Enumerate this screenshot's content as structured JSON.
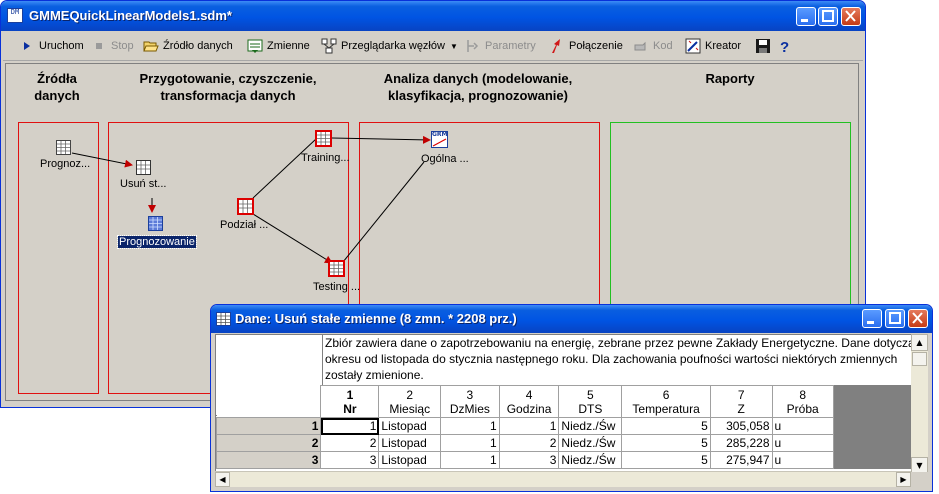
{
  "main_window": {
    "app_icon": "DM",
    "title": "GMMEQuickLinearModels1.sdm*"
  },
  "toolbar": {
    "run": "Uruchom",
    "stop": "Stop",
    "data_source": "Źródło danych",
    "variables": "Zmienne",
    "node_browser": "Przeglądarka węzłów",
    "parameters": "Parametry",
    "connection": "Połączenie",
    "code": "Kod",
    "wizard": "Kreator"
  },
  "columns": {
    "sources": "Źródła\ndanych",
    "preparation": "Przygotowanie, czyszczenie,\ntransformacja danych",
    "analysis": "Analiza danych (modelowanie,\nklasyfikacja, prognozowanie)",
    "reports": "Raporty"
  },
  "nodes": {
    "prognoz": "Prognoz...",
    "usun": "Usuń st...",
    "prognozowanie": "Prognozowanie",
    "podzial": "Podział ...",
    "training": "Training...",
    "testing": "Testing ...",
    "ogolna": "Ogólna ...",
    "ogolna_icon_text": "GRM"
  },
  "data_window": {
    "title": "Dane: Usuń stałe zmienne (8 zmn. * 2208 prz.)",
    "note": "Zbiór zawiera dane o zapotrzebowaniu na energię, zebrane przez pewne Zakłady Energetyczne. Dane dotyczą okresu od listopada do stycznia następnego roku. Dla zachowania poufności wartości niektórych zmiennych zostały zmienione.",
    "columns": [
      {
        "num": "1",
        "name": "Nr"
      },
      {
        "num": "2",
        "name": "Miesiąc"
      },
      {
        "num": "3",
        "name": "DzMies"
      },
      {
        "num": "4",
        "name": "Godzina"
      },
      {
        "num": "5",
        "name": "DTS"
      },
      {
        "num": "6",
        "name": "Temperatura"
      },
      {
        "num": "7",
        "name": "Z"
      },
      {
        "num": "8",
        "name": "Próba"
      }
    ],
    "rows": [
      {
        "rn": "1",
        "c1": "1",
        "c2": "Listopad",
        "c3": "1",
        "c4": "1",
        "c5": "Niedz./Św",
        "c6": "5",
        "c7": "305,058",
        "c8": "u"
      },
      {
        "rn": "2",
        "c1": "2",
        "c2": "Listopad",
        "c3": "1",
        "c4": "2",
        "c5": "Niedz./Św",
        "c6": "5",
        "c7": "285,228",
        "c8": "u"
      },
      {
        "rn": "3",
        "c1": "3",
        "c2": "Listopad",
        "c3": "1",
        "c4": "3",
        "c5": "Niedz./Św",
        "c6": "5",
        "c7": "275,947",
        "c8": "u"
      }
    ]
  }
}
